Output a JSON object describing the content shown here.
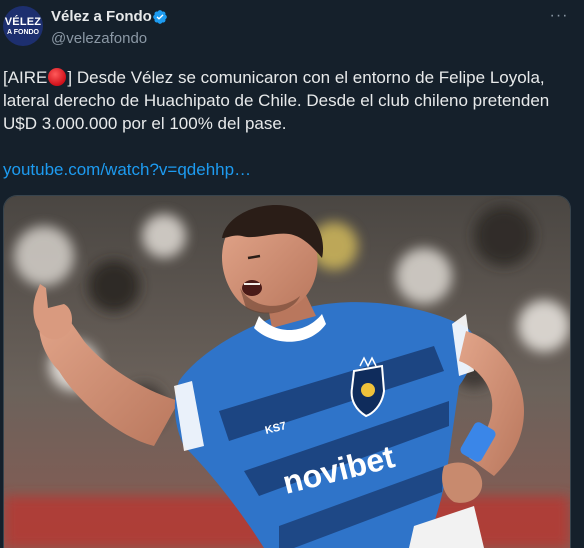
{
  "author": {
    "avatar_line1": "VÉLEZ",
    "avatar_line2": "A FONDO",
    "name": "Vélez a Fondo",
    "handle": "@velezafondo"
  },
  "menu": {
    "more_label": "···"
  },
  "tweet": {
    "line1_prefix": "[AIRE",
    "line1_suffix": "] Desde Vélez se comunicaron con el entorno de Felipe Loyola,",
    "line2": "lateral derecho de Huachipato de Chile. Desde el club chileno pretenden",
    "line3": "U$D 3.000.000 por el 100% del pase.",
    "link": "youtube.com/watch?v=qdehhp…"
  },
  "media": {
    "sponsor": "novibet",
    "kit_brand": "KS7"
  },
  "colors": {
    "background": "#15202b",
    "accent": "#1d9bf0",
    "jersey": "#2f74c9",
    "live_dot": "#e0245e"
  },
  "icons": {
    "verified": "verified-badge-icon",
    "more": "more-icon",
    "live": "red-circle-icon"
  }
}
